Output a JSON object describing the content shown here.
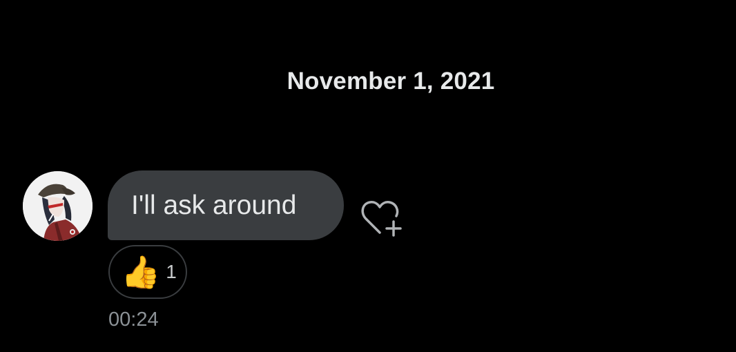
{
  "date_separator": "November 1, 2021",
  "message": {
    "text": "I'll ask around",
    "time": "00:24",
    "avatar": "user-avatar",
    "reaction": {
      "emoji": "👍",
      "count": "1"
    },
    "add_reaction_icon": "heart-plus-icon"
  },
  "colors": {
    "background": "#000000",
    "bubble": "#3a3d40",
    "text": "#e7e9ea",
    "muted": "#8b9196"
  }
}
